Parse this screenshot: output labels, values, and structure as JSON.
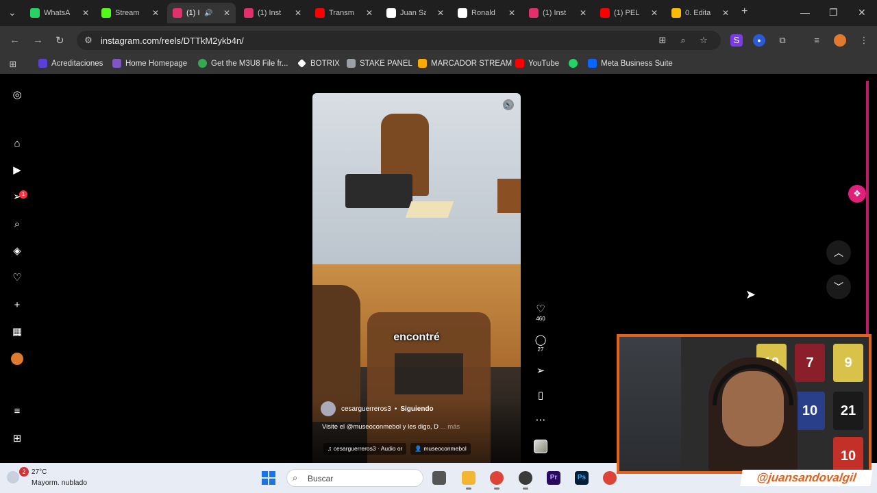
{
  "browser": {
    "tabs": [
      {
        "title": "WhatsA",
        "favicon_color": "#25d366",
        "active": false
      },
      {
        "title": "Stream",
        "favicon_color": "#53fc18",
        "active": false
      },
      {
        "title": "(1) I",
        "favicon_color": "#e1306c",
        "active": true
      },
      {
        "title": "(1) Inst",
        "favicon_color": "#e1306c",
        "active": false
      },
      {
        "title": "Transm",
        "favicon_color": "#ff0000",
        "active": false
      },
      {
        "title": "Juan Sa",
        "favicon_color": "#ffffff",
        "active": false
      },
      {
        "title": "Ronald",
        "favicon_color": "#ffffff",
        "active": false
      },
      {
        "title": "(1) Inst",
        "favicon_color": "#e1306c",
        "active": false
      },
      {
        "title": "(1) PEL",
        "favicon_color": "#ff0000",
        "active": false
      },
      {
        "title": "0. Edita",
        "favicon_color": "#fbbc04",
        "active": false
      }
    ],
    "url": "instagram.com/reels/DTTkM2ykb4n/",
    "bookmarks": [
      {
        "label": "Acreditaciones",
        "icon_color": "#5b3fd6"
      },
      {
        "label": "Home Homepage",
        "icon_color": "#7e57c2"
      },
      {
        "label": "Get the M3U8 File fr...",
        "icon_color": "#34a853"
      },
      {
        "label": "BOTRIX",
        "icon_color": "#ffffff"
      },
      {
        "label": "STAKE PANEL",
        "icon_color": "#9aa0a6"
      },
      {
        "label": "MARCADOR STREAM",
        "icon_color": "#f9ab00"
      },
      {
        "label": "YouTube",
        "icon_color": "#ff0000"
      },
      {
        "label": "",
        "icon_color": "#25d366"
      },
      {
        "label": "Meta Business Suite",
        "icon_color": "#0866ff"
      }
    ]
  },
  "sidebar": {
    "notification_count": "1"
  },
  "reel": {
    "caption": "encontré",
    "author": "cesarguerreros3",
    "separator": "•",
    "follow_status": "Siguiendo",
    "description": "Visite el @museoconmebol y les digo, D",
    "more": "... más",
    "audio": "cesarguerreros3 · Audio or",
    "tagged": "museoconmebol",
    "likes": "460",
    "comments": "27"
  },
  "overlay": {
    "handle": "@juansandovalgil",
    "jerseys": [
      "10",
      "7",
      "9",
      "10",
      "21",
      "10"
    ]
  },
  "taskbar": {
    "temperature": "27°C",
    "condition": "Mayorm. nublado",
    "weather_badge": "2",
    "search_label": "Buscar"
  },
  "colors": {
    "accent": "#e0207a",
    "webcam_border": "#e2611d"
  }
}
